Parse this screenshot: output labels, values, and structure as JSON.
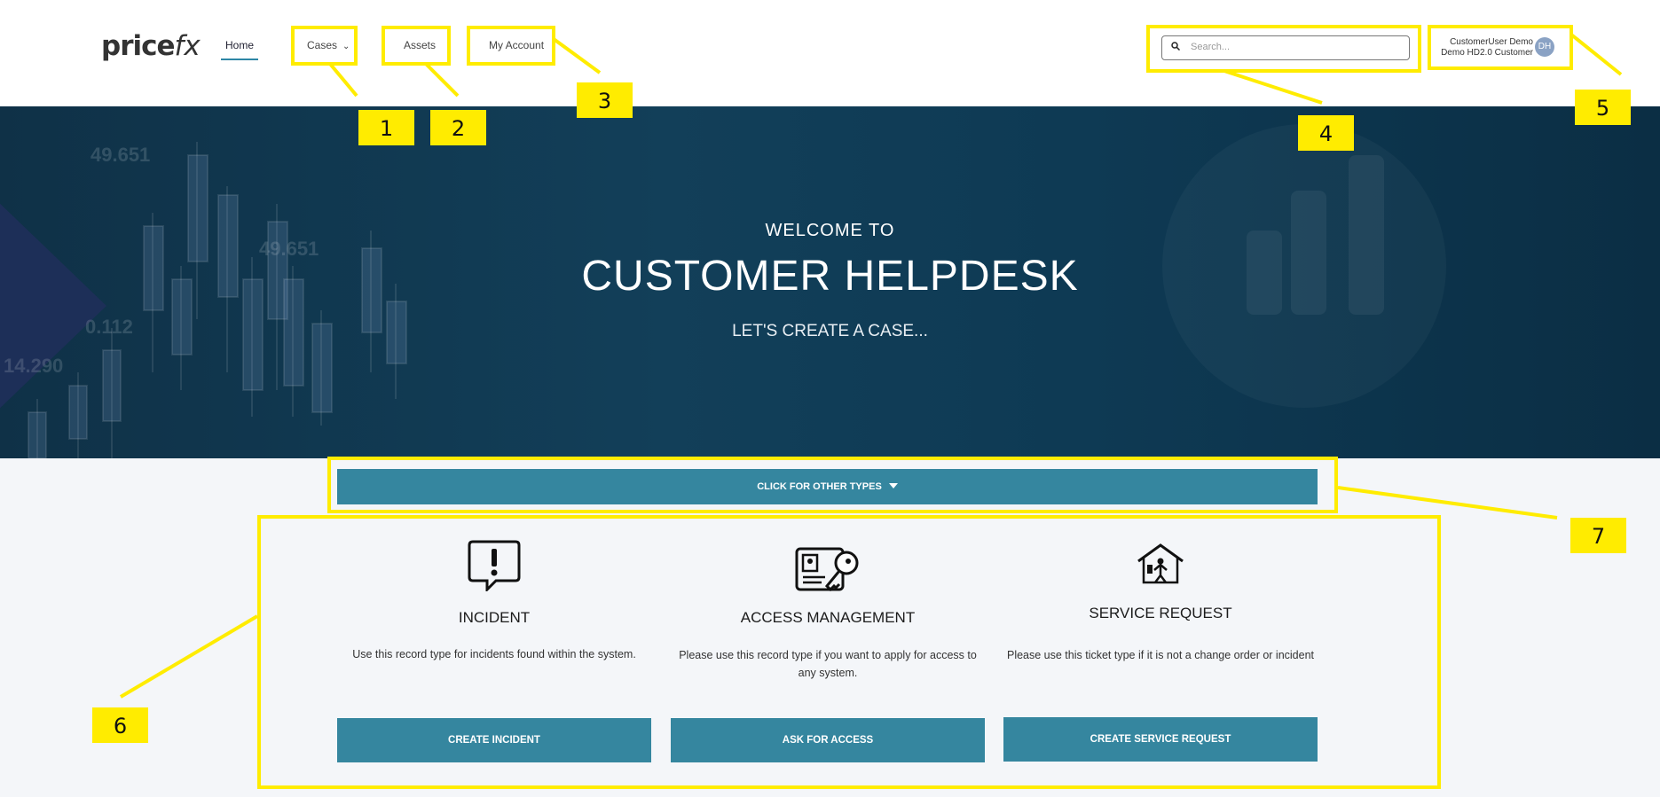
{
  "header": {
    "logo_text": "price",
    "logo_fx": "fx",
    "nav": {
      "home": "Home",
      "cases": "Cases",
      "assets": "Assets",
      "account": "My Account"
    },
    "search_placeholder": "Search...",
    "user_name": "CustomerUser Demo",
    "user_company": "Demo HD2.0 Customer",
    "avatar_initials": "DH"
  },
  "hero": {
    "welcome": "WELCOME TO",
    "title": "CUSTOMER HELPDESK",
    "subtitle": "LET'S CREATE A CASE...",
    "bg_numbers": [
      "49.651",
      "49.651",
      "0.112",
      "14.290"
    ]
  },
  "types_button": "CLICK FOR OTHER TYPES",
  "cards": [
    {
      "title": "INCIDENT",
      "description": "Use this record type for incidents found within the system.",
      "button": "CREATE INCIDENT",
      "icon": "incident-speech-icon"
    },
    {
      "title": "ACCESS MANAGEMENT",
      "description": "Please use this record type if you want to apply for access to any system.",
      "button": "ASK FOR ACCESS",
      "icon": "access-key-card-icon"
    },
    {
      "title": "SERVICE REQUEST",
      "description": "Please use this ticket type if it is not a change order or incident",
      "button": "CREATE SERVICE REQUEST",
      "icon": "service-house-icon"
    }
  ],
  "annotations": [
    "1",
    "2",
    "3",
    "4",
    "5",
    "6",
    "7"
  ],
  "colors": {
    "accent": "#35869f",
    "highlight": "#ffec00",
    "hero": "#0f3147"
  }
}
